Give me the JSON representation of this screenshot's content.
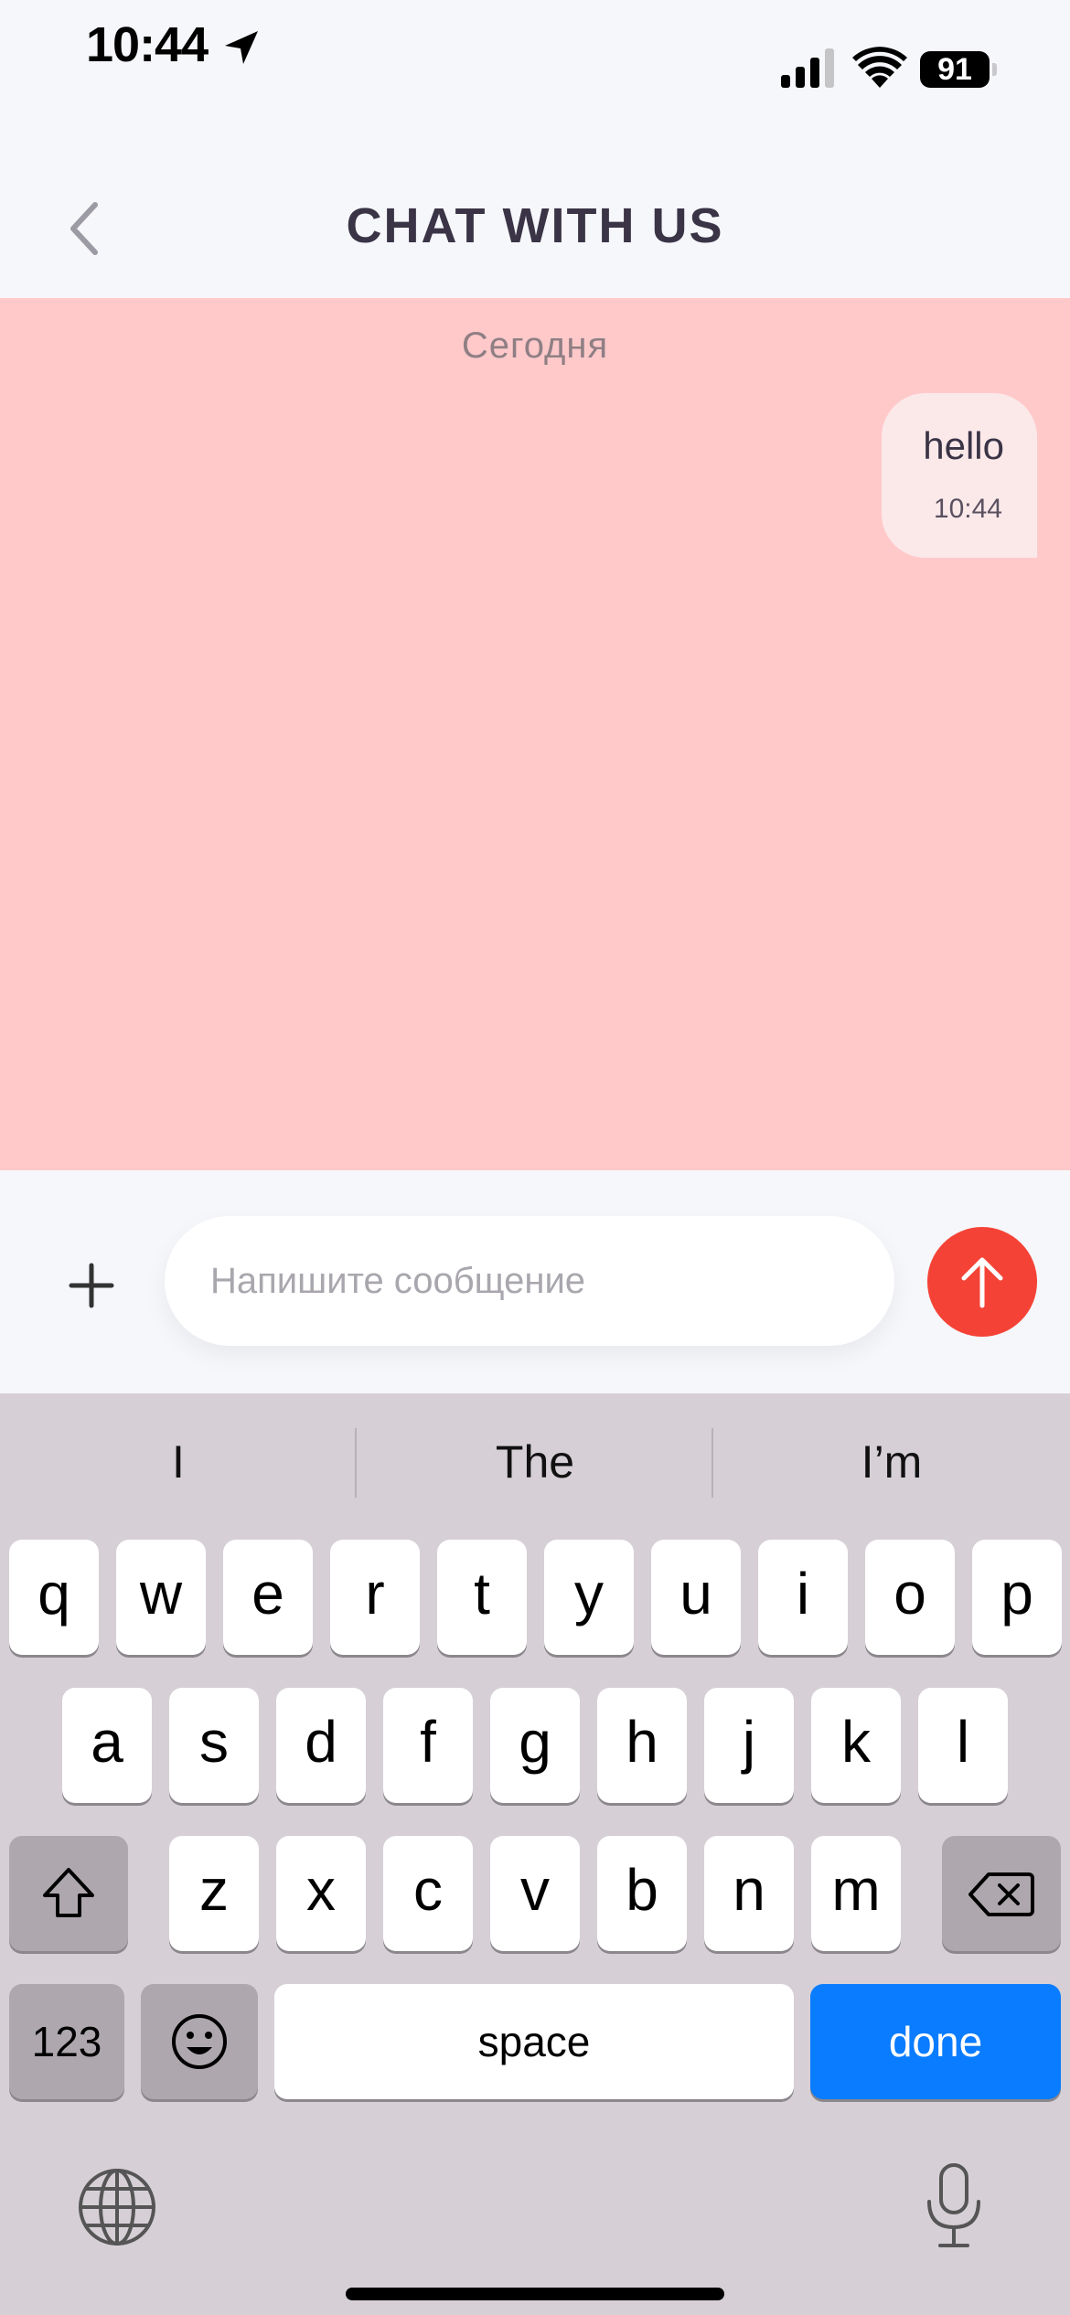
{
  "status_bar": {
    "time": "10:44",
    "battery": "91"
  },
  "header": {
    "title": "CHAT WITH US"
  },
  "chat": {
    "date_label": "Сегодня",
    "messages": [
      {
        "text": "hello",
        "time": "10:44",
        "sender": "user"
      }
    ]
  },
  "composer": {
    "placeholder": "Напишите сообщение",
    "value": ""
  },
  "keyboard": {
    "suggestions": [
      "I",
      "The",
      "I’m"
    ],
    "row1": [
      "q",
      "w",
      "e",
      "r",
      "t",
      "y",
      "u",
      "i",
      "o",
      "p"
    ],
    "row2": [
      "a",
      "s",
      "d",
      "f",
      "g",
      "h",
      "j",
      "k",
      "l"
    ],
    "row3": [
      "z",
      "x",
      "c",
      "v",
      "b",
      "n",
      "m"
    ],
    "numbers_label": "123",
    "space_label": "space",
    "done_label": "done"
  },
  "colors": {
    "chat_background": "#ffc9ca",
    "bubble": "#fbe9ea",
    "send_button": "#f44336",
    "done_key": "#0a7cff"
  }
}
